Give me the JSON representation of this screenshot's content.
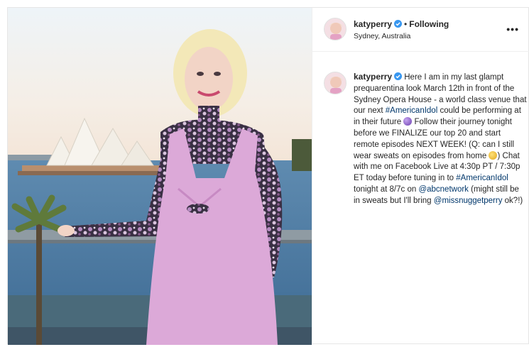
{
  "post": {
    "username": "katyperry",
    "follow_status": "Following",
    "separator": "•",
    "location": "Sydney, Australia",
    "more_label": "•••",
    "caption": {
      "username": "katyperry",
      "part1": " Here I am in my last glampt prequarentina look March 12th in front of the Sydney Opera House - a world class venue that our next ",
      "hashtag1": "#AmericanIdol",
      "part2": " could be performing at in their future ",
      "part3": " Follow their journey tonight before we FINALIZE our top 20 and start remote episodes NEXT WEEK! (Q: can I still wear sweats on episodes from home ",
      "part4": ") Chat with me on Facebook Live at 4:30p PT / 7:30p ET today before tuning in to ",
      "hashtag2": "#AmericanIdol",
      "part5": " tonight at 8/7c on ",
      "mention1": "@abcnetwork",
      "part6": " (might still be in sweats but I'll bring ",
      "mention2": "@missnuggetperry",
      "part7": " ok?!)"
    },
    "icons": {
      "verified": "verified-badge-icon",
      "emoji1": "crystal-ball-emoji",
      "emoji2": "grimace-emoji",
      "more": "more-options-icon"
    },
    "colors": {
      "verified": "#3897f0",
      "link": "#00376b",
      "dress": "#d9a6d6"
    }
  }
}
